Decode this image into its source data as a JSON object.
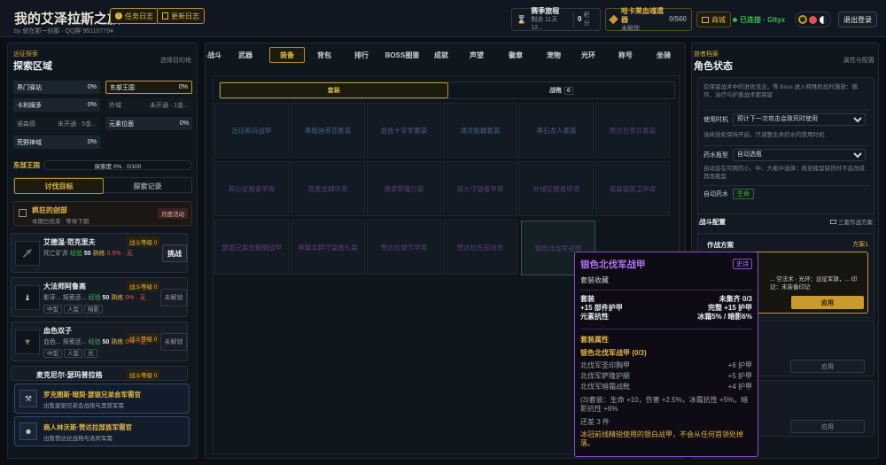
{
  "header": {
    "title": "我的艾泽拉斯之旅",
    "subtitle": "by 就在那一刹那 · QQ群 951107794",
    "task_log": "任务日志",
    "update_log": "更新日志",
    "season": {
      "label": "赛季旅程",
      "sub": "剩余 11天12...",
      "points": "0",
      "points_label": "积分"
    },
    "arena": {
      "label": "哈卡莱血魂遗器",
      "sub": "未解锁",
      "count": "0/560"
    },
    "shop": "商城",
    "connected": "已连接 · Gltyx",
    "logout": "退出登录"
  },
  "left": {
    "small_title": "远征探索",
    "title": "探索区域",
    "hint": "选择目的地",
    "areas": [
      {
        "name": "界门驿站",
        "value": "0%"
      },
      {
        "name": "东部王国",
        "value": "0%"
      },
      {
        "name": "卡利姆多",
        "value": "0%"
      },
      {
        "name": "外域",
        "value": "未开通 · 1金..."
      },
      {
        "name": "诺森德",
        "value": "未开通 · 5金..."
      },
      {
        "name": "元素位面",
        "value": "0%"
      },
      {
        "name": "荒野神域",
        "value": "0%"
      }
    ],
    "progress": {
      "name": "东部王国",
      "label": "探索度 0% · 0/100"
    },
    "tabs": {
      "hunt": "讨伐目标",
      "records": "探索记录"
    },
    "event": {
      "title": "疯狂的刽部",
      "sub": "本期已结束 · 等待下期",
      "badge": "月度活动"
    },
    "enemies": [
      {
        "name": "艾德温·范克里夫",
        "level": "战斗等级 0",
        "line": "死亡矿井",
        "exp_label": "经验",
        "exp": "50",
        "rate_label": "熟练",
        "rate": "0.5% · 无",
        "tags": [],
        "action": "挑战"
      },
      {
        "name": "大法师阿鲁高",
        "level": "战斗等级 0",
        "line": "影牙... 探索还...",
        "exp_label": "经验",
        "exp": "50",
        "rate_label": "熟练",
        "rate": "0% · 无",
        "tags": [
          "中型",
          "人型",
          "暗影"
        ],
        "action": "未解锁"
      },
      {
        "name": "血色双子",
        "level": "战斗等级 0",
        "line": "血色... 探索还...",
        "exp_label": "经验",
        "exp": "50",
        "rate_label": "熟练",
        "rate": "0% · 无",
        "tags": [
          "中型",
          "人型",
          "光"
        ],
        "action": "未解锁"
      },
      {
        "name": "麦克尼尔·瑟玛普拉格",
        "level": "战斗等级 0",
        "line": "",
        "exp_label": "",
        "exp": "",
        "rate_label": "",
        "rate": "",
        "tags": [],
        "action": ""
      }
    ],
    "merchants": [
      {
        "name": "罗克图斯·暗契·瑟银兄弟会军需官",
        "sub": "出售瑟银兄弟会战袍与黑铁军需"
      },
      {
        "name": "商人林沃斯·赞达拉部族军需官",
        "sub": "出售赞达拉战袍与洛阿军需"
      }
    ]
  },
  "middle": {
    "tabs": [
      "战斗",
      "武器",
      "装备",
      "背包",
      "排行",
      "BOSS图鉴",
      "成就",
      "声望",
      "徽章",
      "宠物",
      "光环",
      "称号",
      "坐骑"
    ],
    "active_tab": "装备",
    "subtabs": {
      "set": "套装",
      "armor": "战袍",
      "armor_count": "0"
    },
    "sets": [
      "远征断兵战甲",
      "黑暗迪菲亚套装",
      "血色十字军套装",
      "通灵骷髅套装",
      "黑石龙人套装",
      "赞达拉祭仪套装",
      "其拉征服者甲胄",
      "亚麦龙鳞甲胄",
      "翡翠梦魇行装",
      "熔火守望者甲胄",
      "外域征服者甲胄",
      "诺森德英卫甲胄",
      "瑟银兄弟会精钢战甲",
      "黑曜龙群守望者礼装",
      "赞达拉便节甲胄",
      "赞达拉先知法衣",
      "银色北伐军战甲"
    ]
  },
  "tooltip": {
    "title": "银色北伐军战甲",
    "badge": "史诗",
    "sub": "套装收藏",
    "rows": [
      {
        "k": "套装",
        "v": "未集齐 0/3"
      },
      {
        "k": "+15 部件护甲",
        "v": "完整 +15 护甲"
      },
      {
        "k": "元素抗性",
        "v": "冰霜5% / 暗影6%"
      }
    ],
    "attr_title": "套装属性",
    "set_name": "银色北伐军战甲 (0/3)",
    "pieces": [
      {
        "k": "北伐军圣印胸甲",
        "v": "+6 护甲"
      },
      {
        "k": "北伐军萨隆护腿",
        "v": "+5 护甲"
      },
      {
        "k": "北伐军暗霜战靴",
        "v": "+4 护甲"
      }
    ],
    "bonus": "(3)套装：生命 +10，伤害 +2.5%，冰霜抗性 +5%，暗影抗性 +6%",
    "missing": "还差 3 件",
    "lore": "冰冠前线精锐使用的银白战甲，不会从任何首领处掉落。"
  },
  "right": {
    "small_title": "旅者档案",
    "title": "角色状态",
    "hint": "属性与配置",
    "note": "仅保留战术中的进攻流派，等 Boss 进入特殊阶段时施放：循环、治疗与护盾战术都保留",
    "timing_label": "使用时机",
    "timing_value": "预计下一次攻击会致死时使用",
    "timing_note": "连续挂机保持开启，只调整生命药水的使用时机",
    "potion_label": "药水瓶型",
    "potion_value": "自动选瓶",
    "potion_note": "自动会在可用的小、中、大瓶中选择：按足瓶型缺货时不会改成其他瓶型",
    "auto_label": "自动药水",
    "auto_value": "生命",
    "battle_config": "战斗配置",
    "battle_hint": "三套作战方案",
    "plan_label": "作战方案",
    "plan_value": "方案1",
    "plan_note": "... 空法术 · 光环：远征军旗，... 印记：未装备印记",
    "apply": "应用"
  }
}
